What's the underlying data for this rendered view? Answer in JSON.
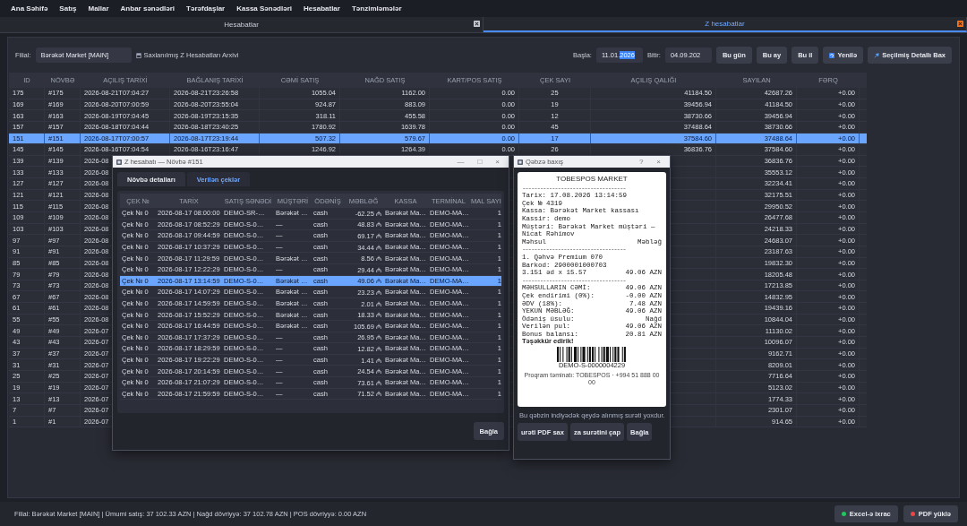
{
  "menu": [
    "Ana Səhifə",
    "Satış",
    "Mallar",
    "Anbar sənədləri",
    "Tərəfdaşlar",
    "Kassa Sənədləri",
    "Hesabatlar",
    "Tənzimləmələr"
  ],
  "tabs": [
    {
      "label": "Hesabatlar",
      "selected": false
    },
    {
      "label": "Z hesabatlar",
      "selected": true
    }
  ],
  "filter": {
    "branch_label": "Filial:",
    "branch_value": "Bərəkət Market [MAIN]",
    "archive_link": "Saxlanılmış Z Hesabatları Arxivi",
    "start_label": "Başla:",
    "start_value": "11.01.",
    "start_selected_text": "2026",
    "end_label": "Bitir:",
    "end_value": "04.09.202",
    "buttons": [
      {
        "label": "Bu gün",
        "kind": "plain"
      },
      {
        "label": "Bu ay",
        "kind": "plain"
      },
      {
        "label": "Bu il",
        "kind": "plain"
      },
      {
        "label": "Yenilə",
        "kind": "refresh"
      },
      {
        "label": "Seçilmiş Detallı Bax",
        "kind": "detail"
      }
    ]
  },
  "table": {
    "columns": [
      "ID",
      "NÖVBƏ",
      "AÇILIŞ TARİXİ",
      "BAĞLANIŞ TARİXİ",
      "CƏMİ SATIŞ",
      "NAĞD SATIŞ",
      "KART/POS SATIŞ",
      "ÇEK SAYI",
      "AÇILIŞ QALIĞI",
      "SAYILAN",
      "FƏRQ"
    ],
    "rows": [
      {
        "id": "175",
        "shift": "#175",
        "opened": "2026-08-21T07:04:27",
        "closed": "2026-08-21T23:26:58",
        "total": "1055.04",
        "cash": "1162.00",
        "card": "0.00",
        "receipts": "25",
        "opening": "41184.50",
        "counted": "42687.26",
        "diff": "+0.00",
        "selected": false
      },
      {
        "id": "169",
        "shift": "#169",
        "opened": "2026-08-20T07:00:59",
        "closed": "2026-08-20T23:55:04",
        "total": "924.87",
        "cash": "883.09",
        "card": "0.00",
        "receipts": "19",
        "opening": "39456.94",
        "counted": "41184.50",
        "diff": "+0.00",
        "selected": false
      },
      {
        "id": "163",
        "shift": "#163",
        "opened": "2026-08-19T07:04:45",
        "closed": "2026-08-19T23:15:35",
        "total": "318.11",
        "cash": "455.58",
        "card": "0.00",
        "receipts": "12",
        "opening": "38730.66",
        "counted": "39456.94",
        "diff": "+0.00",
        "selected": false
      },
      {
        "id": "157",
        "shift": "#157",
        "opened": "2026-08-18T07:04:44",
        "closed": "2026-08-18T23:40:25",
        "total": "1780.92",
        "cash": "1639.78",
        "card": "0.00",
        "receipts": "45",
        "opening": "37488.64",
        "counted": "38730.66",
        "diff": "+0.00",
        "selected": false
      },
      {
        "id": "151",
        "shift": "#151",
        "opened": "2026-08-17T07:00:57",
        "closed": "2026-08-17T23:19:44",
        "total": "507.32",
        "cash": "579.67",
        "card": "0.00",
        "receipts": "17",
        "opening": "37584.60",
        "counted": "37488.64",
        "diff": "+0.00",
        "selected": true
      },
      {
        "id": "145",
        "shift": "#145",
        "opened": "2026-08-16T07:04:54",
        "closed": "2026-08-16T23:16:47",
        "total": "1246.92",
        "cash": "1264.39",
        "card": "0.00",
        "receipts": "26",
        "opening": "36836.76",
        "counted": "37584.60",
        "diff": "+0.00",
        "selected": false
      },
      {
        "id": "139",
        "shift": "#139",
        "opened": "2026-08",
        "counted": "36836.76",
        "diff": "+0.00",
        "selected": false
      },
      {
        "id": "133",
        "shift": "#133",
        "opened": "2026-08",
        "counted": "35553.12",
        "diff": "+0.00",
        "selected": false
      },
      {
        "id": "127",
        "shift": "#127",
        "opened": "2026-08",
        "counted": "32234.41",
        "diff": "+0.00",
        "selected": false
      },
      {
        "id": "121",
        "shift": "#121",
        "opened": "2026-08",
        "counted": "32175.51",
        "diff": "+0.00",
        "selected": false
      },
      {
        "id": "115",
        "shift": "#115",
        "opened": "2026-08",
        "counted": "29950.52",
        "diff": "+0.00",
        "selected": false
      },
      {
        "id": "109",
        "shift": "#109",
        "opened": "2026-08",
        "counted": "26477.68",
        "diff": "+0.00",
        "selected": false
      },
      {
        "id": "103",
        "shift": "#103",
        "opened": "2026-08",
        "counted": "24218.33",
        "diff": "+0.00",
        "selected": false
      },
      {
        "id": "97",
        "shift": "#97",
        "opened": "2026-08",
        "counted": "24683.07",
        "diff": "+0.00",
        "selected": false
      },
      {
        "id": "91",
        "shift": "#91",
        "opened": "2026-08",
        "counted": "23187.63",
        "diff": "+0.00",
        "selected": false
      },
      {
        "id": "85",
        "shift": "#85",
        "opened": "2026-08",
        "counted": "19832.30",
        "diff": "+0.00",
        "selected": false
      },
      {
        "id": "79",
        "shift": "#79",
        "opened": "2026-08",
        "counted": "18205.48",
        "diff": "+0.00",
        "selected": false
      },
      {
        "id": "73",
        "shift": "#73",
        "opened": "2026-08",
        "counted": "17213.85",
        "diff": "+0.00",
        "selected": false
      },
      {
        "id": "67",
        "shift": "#67",
        "opened": "2026-08",
        "counted": "14832.95",
        "diff": "+0.00",
        "selected": false
      },
      {
        "id": "61",
        "shift": "#61",
        "opened": "2026-08",
        "counted": "19439.16",
        "diff": "+0.00",
        "selected": false
      },
      {
        "id": "55",
        "shift": "#55",
        "opened": "2026-08",
        "counted": "10844.04",
        "diff": "+0.00",
        "selected": false
      },
      {
        "id": "49",
        "shift": "#49",
        "opened": "2026-07",
        "counted": "11130.02",
        "diff": "+0.00",
        "selected": false
      },
      {
        "id": "43",
        "shift": "#43",
        "opened": "2026-07",
        "counted": "10096.07",
        "diff": "+0.00",
        "selected": false
      },
      {
        "id": "37",
        "shift": "#37",
        "opened": "2026-07",
        "counted": "9162.71",
        "diff": "+0.00",
        "selected": false
      },
      {
        "id": "31",
        "shift": "#31",
        "opened": "2026-07",
        "counted": "8209.01",
        "diff": "+0.00",
        "selected": false
      },
      {
        "id": "25",
        "shift": "#25",
        "opened": "2026-07",
        "counted": "7716.64",
        "diff": "+0.00",
        "selected": false
      },
      {
        "id": "19",
        "shift": "#19",
        "opened": "2026-07",
        "counted": "5123.02",
        "diff": "+0.00",
        "selected": false
      },
      {
        "id": "13",
        "shift": "#13",
        "opened": "2026-07",
        "counted": "1774.33",
        "diff": "+0.00",
        "selected": false
      },
      {
        "id": "7",
        "shift": "#7",
        "opened": "2026-07",
        "counted": "2301.07",
        "diff": "+0.00",
        "selected": false
      },
      {
        "id": "1",
        "shift": "#1",
        "opened": "2026-07",
        "counted": "914.65",
        "diff": "+0.00",
        "selected": false
      }
    ]
  },
  "status_bar": {
    "text": "Filial: Bərəkət Market [MAIN] | Ümumi satış: 37 102.33 AZN | Nağd dövriyyə: 37 102.78 AZN | POS dövriyyə: 0.00 AZN",
    "buttons": [
      {
        "label": "Excel-ə ixrac",
        "color": "#22c55e"
      },
      {
        "label": "PDF yüklə",
        "color": "#ef4444"
      }
    ]
  },
  "z_dialog": {
    "title": "Z hesabatı — Növbə #151",
    "controls": [
      "—",
      "□",
      "×"
    ],
    "tabs": [
      {
        "label": "Növbə detalları",
        "selected": false
      },
      {
        "label": "Verilən çeklər",
        "selected": true
      }
    ],
    "columns": [
      "ÇEK №",
      "TARİX",
      "SATIŞ SƏNƏDİ",
      "MÜŞTƏRİ",
      "ÖDƏNİŞ",
      "MƏBLƏĞ",
      "KASSA",
      "TERMİNAL",
      "MAL SAYI"
    ],
    "rows": [
      {
        "cells": [
          "Çek № 0",
          "2026-08-17 08:00:00",
          "DEMO-SR-…",
          "Bərəkət …",
          "cash",
          "-62.25 ₼",
          "Bərəkət Ma…",
          "DEMO-MA…",
          "1"
        ],
        "selected": false
      },
      {
        "cells": [
          "Çek № 0",
          "2026-08-17 08:52:29",
          "DEMO-S-0…",
          "—",
          "cash",
          "48.83 ₼",
          "Bərəkət Ma…",
          "DEMO-MA…",
          "1"
        ],
        "selected": false
      },
      {
        "cells": [
          "Çek № 0",
          "2026-08-17 09:44:59",
          "DEMO-S-0…",
          "—",
          "cash",
          "69.17 ₼",
          "Bərəkət Ma…",
          "DEMO-MA…",
          "1"
        ],
        "selected": false
      },
      {
        "cells": [
          "Çek № 0",
          "2026-08-17 10:37:29",
          "DEMO-S-0…",
          "—",
          "cash",
          "34.44 ₼",
          "Bərəkət Ma…",
          "DEMO-MA…",
          "1"
        ],
        "selected": false
      },
      {
        "cells": [
          "Çek № 0",
          "2026-08-17 11:29:59",
          "DEMO-S-0…",
          "Bərəkət …",
          "cash",
          "8.56 ₼",
          "Bərəkət Ma…",
          "DEMO-MA…",
          "1"
        ],
        "selected": false
      },
      {
        "cells": [
          "Çek № 0",
          "2026-08-17 12:22:29",
          "DEMO-S-0…",
          "—",
          "cash",
          "29.44 ₼",
          "Bərəkət Ma…",
          "DEMO-MA…",
          "1"
        ],
        "selected": false
      },
      {
        "cells": [
          "Çek № 0",
          "2026-08-17 13:14:59",
          "DEMO-S-0…",
          "Bərəkət …",
          "cash",
          "49.06 ₼",
          "Bərəkət Ma…",
          "DEMO-MA…",
          "1"
        ],
        "selected": true
      },
      {
        "cells": [
          "Çek № 0",
          "2026-08-17 14:07:29",
          "DEMO-S-0…",
          "Bərəkət …",
          "cash",
          "23.23 ₼",
          "Bərəkət Ma…",
          "DEMO-MA…",
          "1"
        ],
        "selected": false
      },
      {
        "cells": [
          "Çek № 0",
          "2026-08-17 14:59:59",
          "DEMO-S-0…",
          "Bərəkət …",
          "cash",
          "2.01 ₼",
          "Bərəkət Ma…",
          "DEMO-MA…",
          "1"
        ],
        "selected": false
      },
      {
        "cells": [
          "Çek № 0",
          "2026-08-17 15:52:29",
          "DEMO-S-0…",
          "Bərəkət …",
          "cash",
          "18.33 ₼",
          "Bərəkət Ma…",
          "DEMO-MA…",
          "1"
        ],
        "selected": false
      },
      {
        "cells": [
          "Çek № 0",
          "2026-08-17 16:44:59",
          "DEMO-S-0…",
          "Bərəkət …",
          "cash",
          "105.69 ₼",
          "Bərəkət Ma…",
          "DEMO-MA…",
          "1"
        ],
        "selected": false
      },
      {
        "cells": [
          "Çek № 0",
          "2026-08-17 17:37:29",
          "DEMO-S-0…",
          "—",
          "cash",
          "26.95 ₼",
          "Bərəkət Ma…",
          "DEMO-MA…",
          "1"
        ],
        "selected": false
      },
      {
        "cells": [
          "Çek № 0",
          "2026-08-17 18:29:59",
          "DEMO-S-0…",
          "—",
          "cash",
          "12.82 ₼",
          "Bərəkət Ma…",
          "DEMO-MA…",
          "1"
        ],
        "selected": false
      },
      {
        "cells": [
          "Çek № 0",
          "2026-08-17 19:22:29",
          "DEMO-S-0…",
          "—",
          "cash",
          "1.41 ₼",
          "Bərəkət Ma…",
          "DEMO-MA…",
          "1"
        ],
        "selected": false
      },
      {
        "cells": [
          "Çek № 0",
          "2026-08-17 20:14:59",
          "DEMO-S-0…",
          "—",
          "cash",
          "24.54 ₼",
          "Bərəkət Ma…",
          "DEMO-MA…",
          "1"
        ],
        "selected": false
      },
      {
        "cells": [
          "Çek № 0",
          "2026-08-17 21:07:29",
          "DEMO-S-0…",
          "—",
          "cash",
          "73.61 ₼",
          "Bərəkət Ma…",
          "DEMO-MA…",
          "1"
        ],
        "selected": false
      },
      {
        "cells": [
          "Çek № 0",
          "2026-08-17 21:59:59",
          "DEMO-S-0…",
          "—",
          "cash",
          "71.52 ₼",
          "Bərəkət Ma…",
          "DEMO-MA…",
          "1"
        ],
        "selected": false
      }
    ],
    "close_button": "Bağla"
  },
  "receipt_dialog": {
    "title": "Qəbzə baxış",
    "controls": [
      "?",
      "×"
    ],
    "lines": [
      {
        "kind": "heading",
        "text": "TOBESPOS MARKET"
      },
      {
        "kind": "rule",
        "text": "-----------------------------------"
      },
      {
        "kind": "line",
        "text": "Tarix: 17.08.2026 13:14:59"
      },
      {
        "kind": "line",
        "text": "Çek № 4319"
      },
      {
        "kind": "line",
        "text": "Kassa: Bərəkət Market kassası"
      },
      {
        "kind": "line",
        "text": "Kassir: demo"
      },
      {
        "kind": "line",
        "text": "Müştəri: Bərəkət Market müştəri —"
      },
      {
        "kind": "line",
        "text": "Nicat Rəhimov"
      },
      {
        "kind": "pair",
        "left": "Məhsul",
        "right": "Məbləğ"
      },
      {
        "kind": "rule",
        "text": "-----------------------------------"
      },
      {
        "kind": "line",
        "text": "1. Qəhvə Premium 070"
      },
      {
        "kind": "line",
        "text": "Barkod: 2900001000703"
      },
      {
        "kind": "pair",
        "left": "3.151 əd x 15.57",
        "right": "49.06 AZN"
      },
      {
        "kind": "rule",
        "text": "-----------------------------------"
      },
      {
        "kind": "pair",
        "left": "MƏHSULLARIN CƏMİ:",
        "right": "49.06 AZN"
      },
      {
        "kind": "pair",
        "left": "Çek endirimi (0%):",
        "right": "-0.00 AZN"
      },
      {
        "kind": "pair",
        "left": "ƏDV (18%):",
        "right": "7.48 AZN"
      },
      {
        "kind": "pair",
        "left": "YEKUN MƏBLƏĞ:",
        "right": "49.06 AZN"
      },
      {
        "kind": "pair",
        "left": "Ödəniş üsulu:",
        "right": "Nağd"
      },
      {
        "kind": "pair",
        "left": "Verilən pul:",
        "right": "49.06 AZN"
      },
      {
        "kind": "pair",
        "left": "Bonus balansı:",
        "right": "20.81 AZN"
      },
      {
        "kind": "thanks",
        "text": "Təşəkkür edirik!"
      },
      {
        "kind": "barcode"
      },
      {
        "kind": "code",
        "text": "DEMO-S-0000004229"
      },
      {
        "kind": "footer",
        "text": "Proqram təminatı: TOBESPOS · +994 51 888 00 00"
      }
    ],
    "note": "Bu qəbzin indiyədək qeydə alınmış surəti yoxdur.",
    "buttons": [
      "urəti PDF sax",
      "za surətini çap",
      "Bağla"
    ]
  }
}
